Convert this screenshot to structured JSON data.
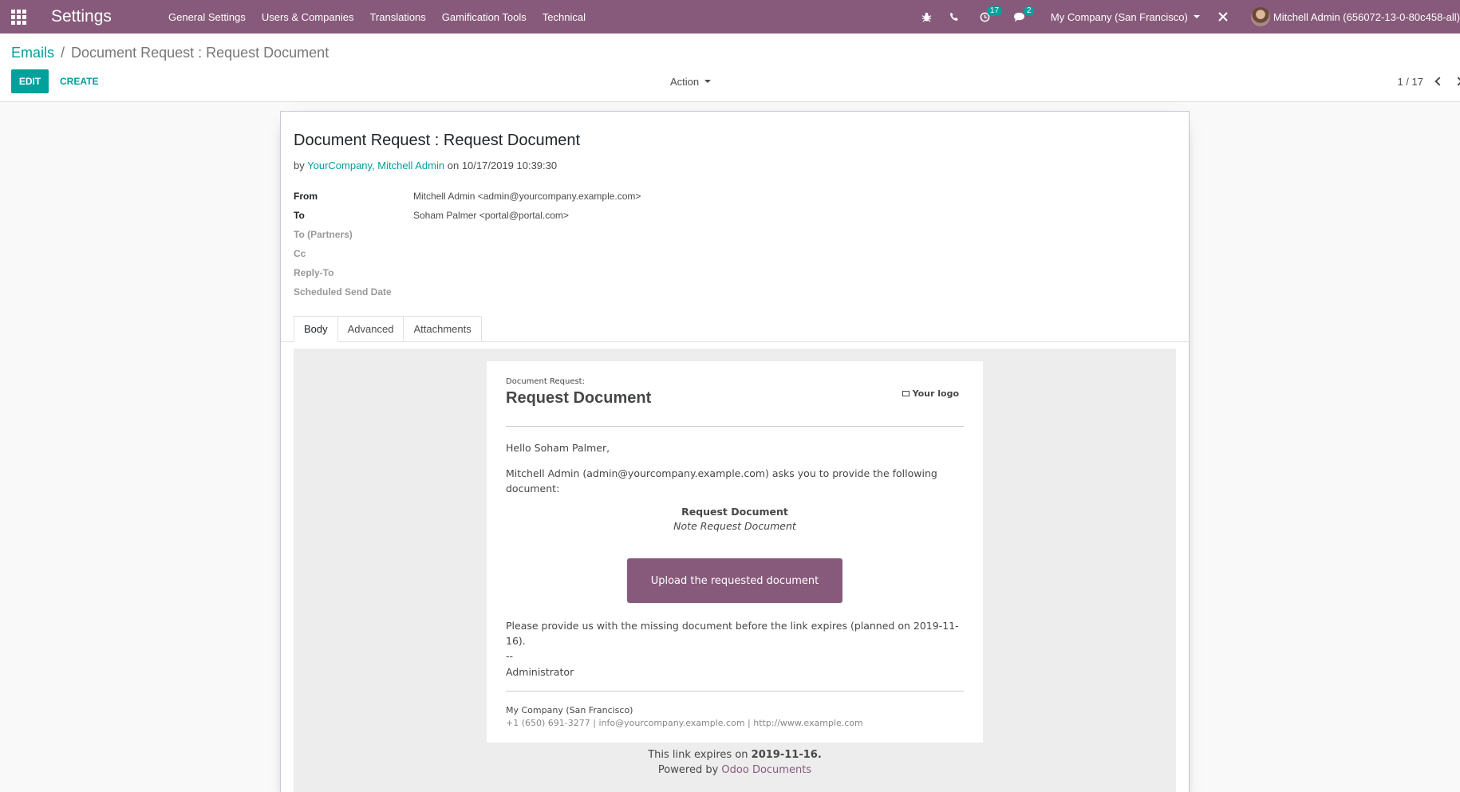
{
  "navbar": {
    "app_name": "Settings",
    "menu": [
      "General Settings",
      "Users & Companies",
      "Translations",
      "Gamification Tools",
      "Technical"
    ],
    "activity_count": "17",
    "message_count": "2",
    "company": "My Company (San Francisco)",
    "user": "Mitchell Admin (656072-13-0-80c458-all)",
    "bg_color": "#875a7b"
  },
  "breadcrumb": {
    "parent": "Emails",
    "separator": "/",
    "current": "Document Request : Request Document"
  },
  "buttons": {
    "edit": "EDIT",
    "create": "CREATE",
    "action": "Action"
  },
  "pager": {
    "counter": "1 / 17"
  },
  "mail": {
    "subject": "Document Request : Request Document",
    "by_prefix": "by",
    "author": "YourCompany, Mitchell Admin",
    "on_prefix": "on",
    "date": "10/17/2019 10:39:30",
    "fields": [
      {
        "label": "From",
        "value": "Mitchell Admin <admin@yourcompany.example.com>"
      },
      {
        "label": "To",
        "value": "Soham Palmer <portal@portal.com>"
      },
      {
        "label": "To (Partners)",
        "value": ""
      },
      {
        "label": "Cc",
        "value": ""
      },
      {
        "label": "Reply-To",
        "value": ""
      },
      {
        "label": "Scheduled Send Date",
        "value": ""
      }
    ],
    "tabs": [
      "Body",
      "Advanced",
      "Attachments"
    ]
  },
  "body": {
    "kicker": "Document Request:",
    "title": "Request Document",
    "logo": "Your logo",
    "greeting": "Hello Soham Palmer,",
    "intro": "Mitchell Admin (admin@yourcompany.example.com) asks you to provide the following document:",
    "doc_name": "Request Document",
    "doc_note": "Note Request Document",
    "upload_button": "Upload the requested document",
    "reminder": "Please provide us with the missing document before the link expires (planned on 2019-11-16).",
    "signature_sep": "--",
    "signature": "Administrator",
    "footer_company": "My Company (San Francisco)",
    "footer_contact": "+1 (650) 691-3277 | info@yourcompany.example.com | http://www.example.com",
    "expire_prefix": "This link expires on",
    "expire_date": "2019-11-16.",
    "powered_prefix": "Powered by",
    "powered_link": "Odoo Documents"
  }
}
